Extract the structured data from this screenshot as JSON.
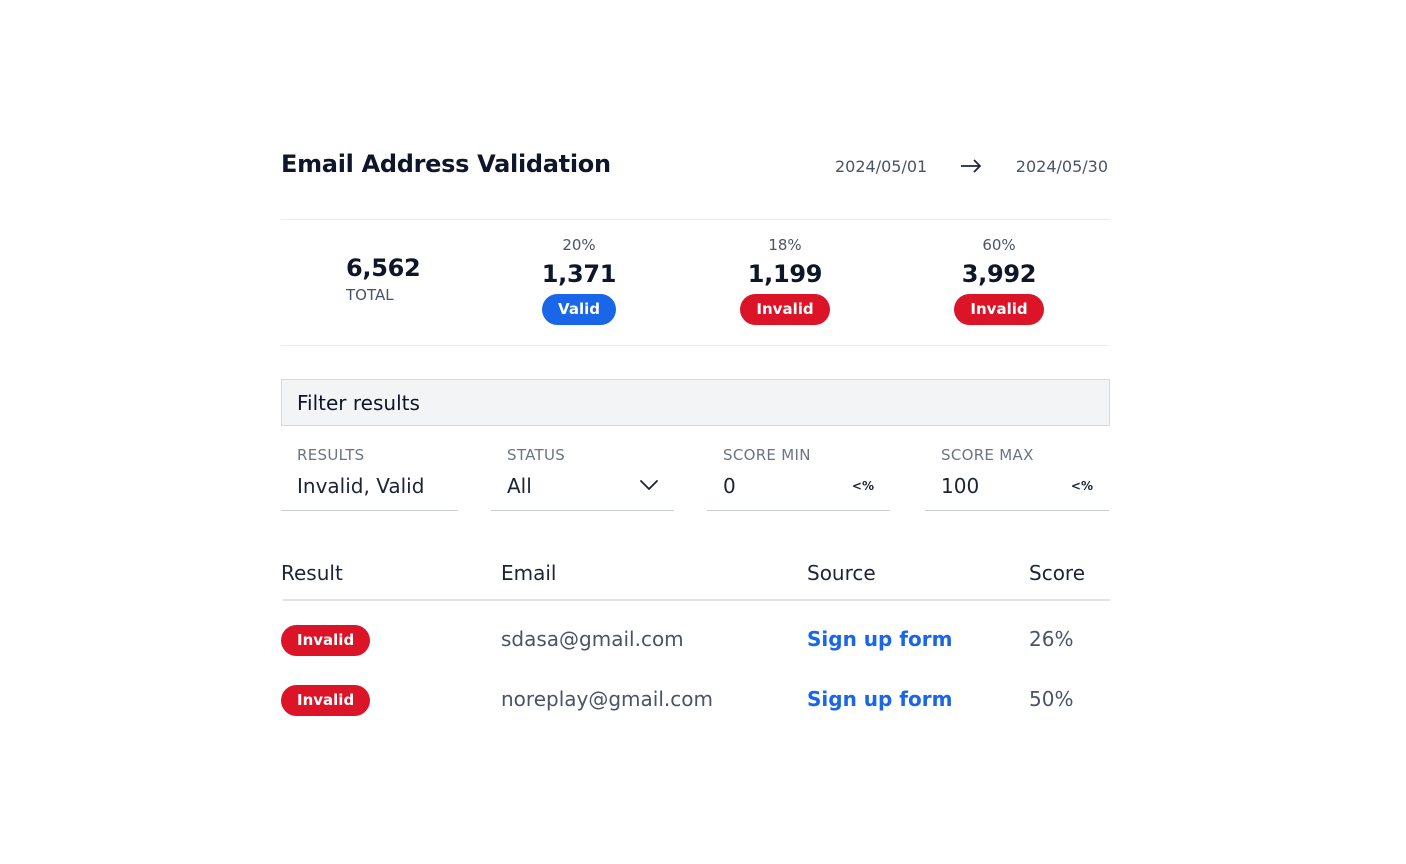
{
  "header": {
    "title": "Email Address Validation",
    "date_start": "2024/05/01",
    "date_end": "2024/05/30"
  },
  "stats": {
    "total": {
      "value": "6,562",
      "label": "TOTAL"
    },
    "groups": [
      {
        "percent": "20%",
        "value": "1,371",
        "badge": "Valid",
        "status": "valid"
      },
      {
        "percent": "18%",
        "value": "1,199",
        "badge": "Invalid",
        "status": "invalid"
      },
      {
        "percent": "60%",
        "value": "3,992",
        "badge": "Invalid",
        "status": "invalid"
      }
    ]
  },
  "filter": {
    "title": "Filter results",
    "fields": [
      {
        "label": "RESULTS",
        "value": "Invalid, Valid"
      },
      {
        "label": "STATUS",
        "value": "All"
      },
      {
        "label": "SCORE MIN",
        "value": "0",
        "suffix": "<%"
      },
      {
        "label": "SCORE MAX",
        "value": "100",
        "suffix": "<%"
      }
    ]
  },
  "table": {
    "headers": [
      "Result",
      "Email",
      "Source",
      "Score"
    ],
    "rows": [
      {
        "result": "Invalid",
        "email": "sdasa@gmail.com",
        "source": "Sign up form",
        "score": "26%"
      },
      {
        "result": "Invalid",
        "email": "noreplay@gmail.com",
        "source": "Sign up form",
        "score": "50%"
      }
    ]
  },
  "colors": {
    "valid": "#1a66e8",
    "invalid": "#dc1428",
    "link": "#1a66e8"
  }
}
